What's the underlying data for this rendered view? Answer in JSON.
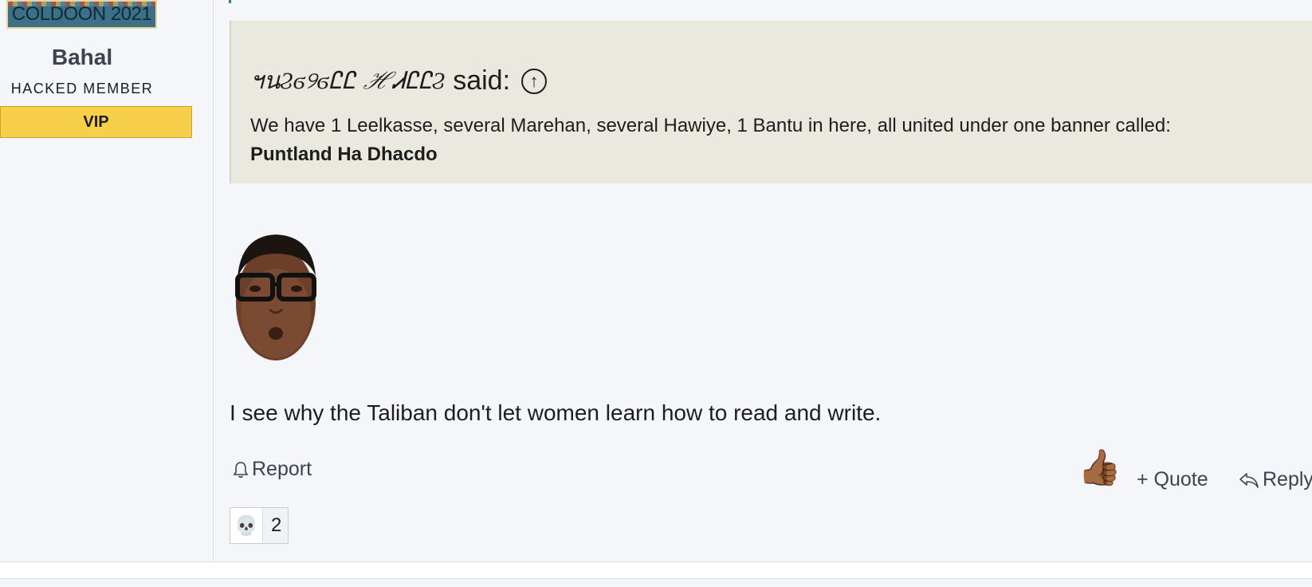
{
  "sidebar": {
    "banner_text": "COLDOON 2021",
    "username": "Bahal",
    "user_title": "HACKED MEMBER",
    "badge": "VIP"
  },
  "quote": {
    "author": "ฯนϨϭ୨ϭᏝᏝ ℋᏗᏝᏝϨ",
    "said": "said:",
    "body_line": "We have 1 Leelkasse, several Marehan, several Hawiye, 1 Bantu in here, all united under one banner called:",
    "body_bold": "Puntland Ha Dhacdo"
  },
  "post": {
    "text": "I see why the Taliban don't let women learn how to read and write."
  },
  "actions": {
    "report": "Report",
    "quote": "+ Quote",
    "reply": "Reply"
  },
  "reactions": [
    {
      "icon": "skull-icon",
      "emoji": "💀",
      "count": "2"
    }
  ],
  "icons": {
    "thumb": "👍🏾",
    "arrow_up": "↑"
  },
  "colors": {
    "vip_badge": "#f7cf4a",
    "quote_bg": "#eae9df",
    "page_bg": "#f5f6fa"
  }
}
